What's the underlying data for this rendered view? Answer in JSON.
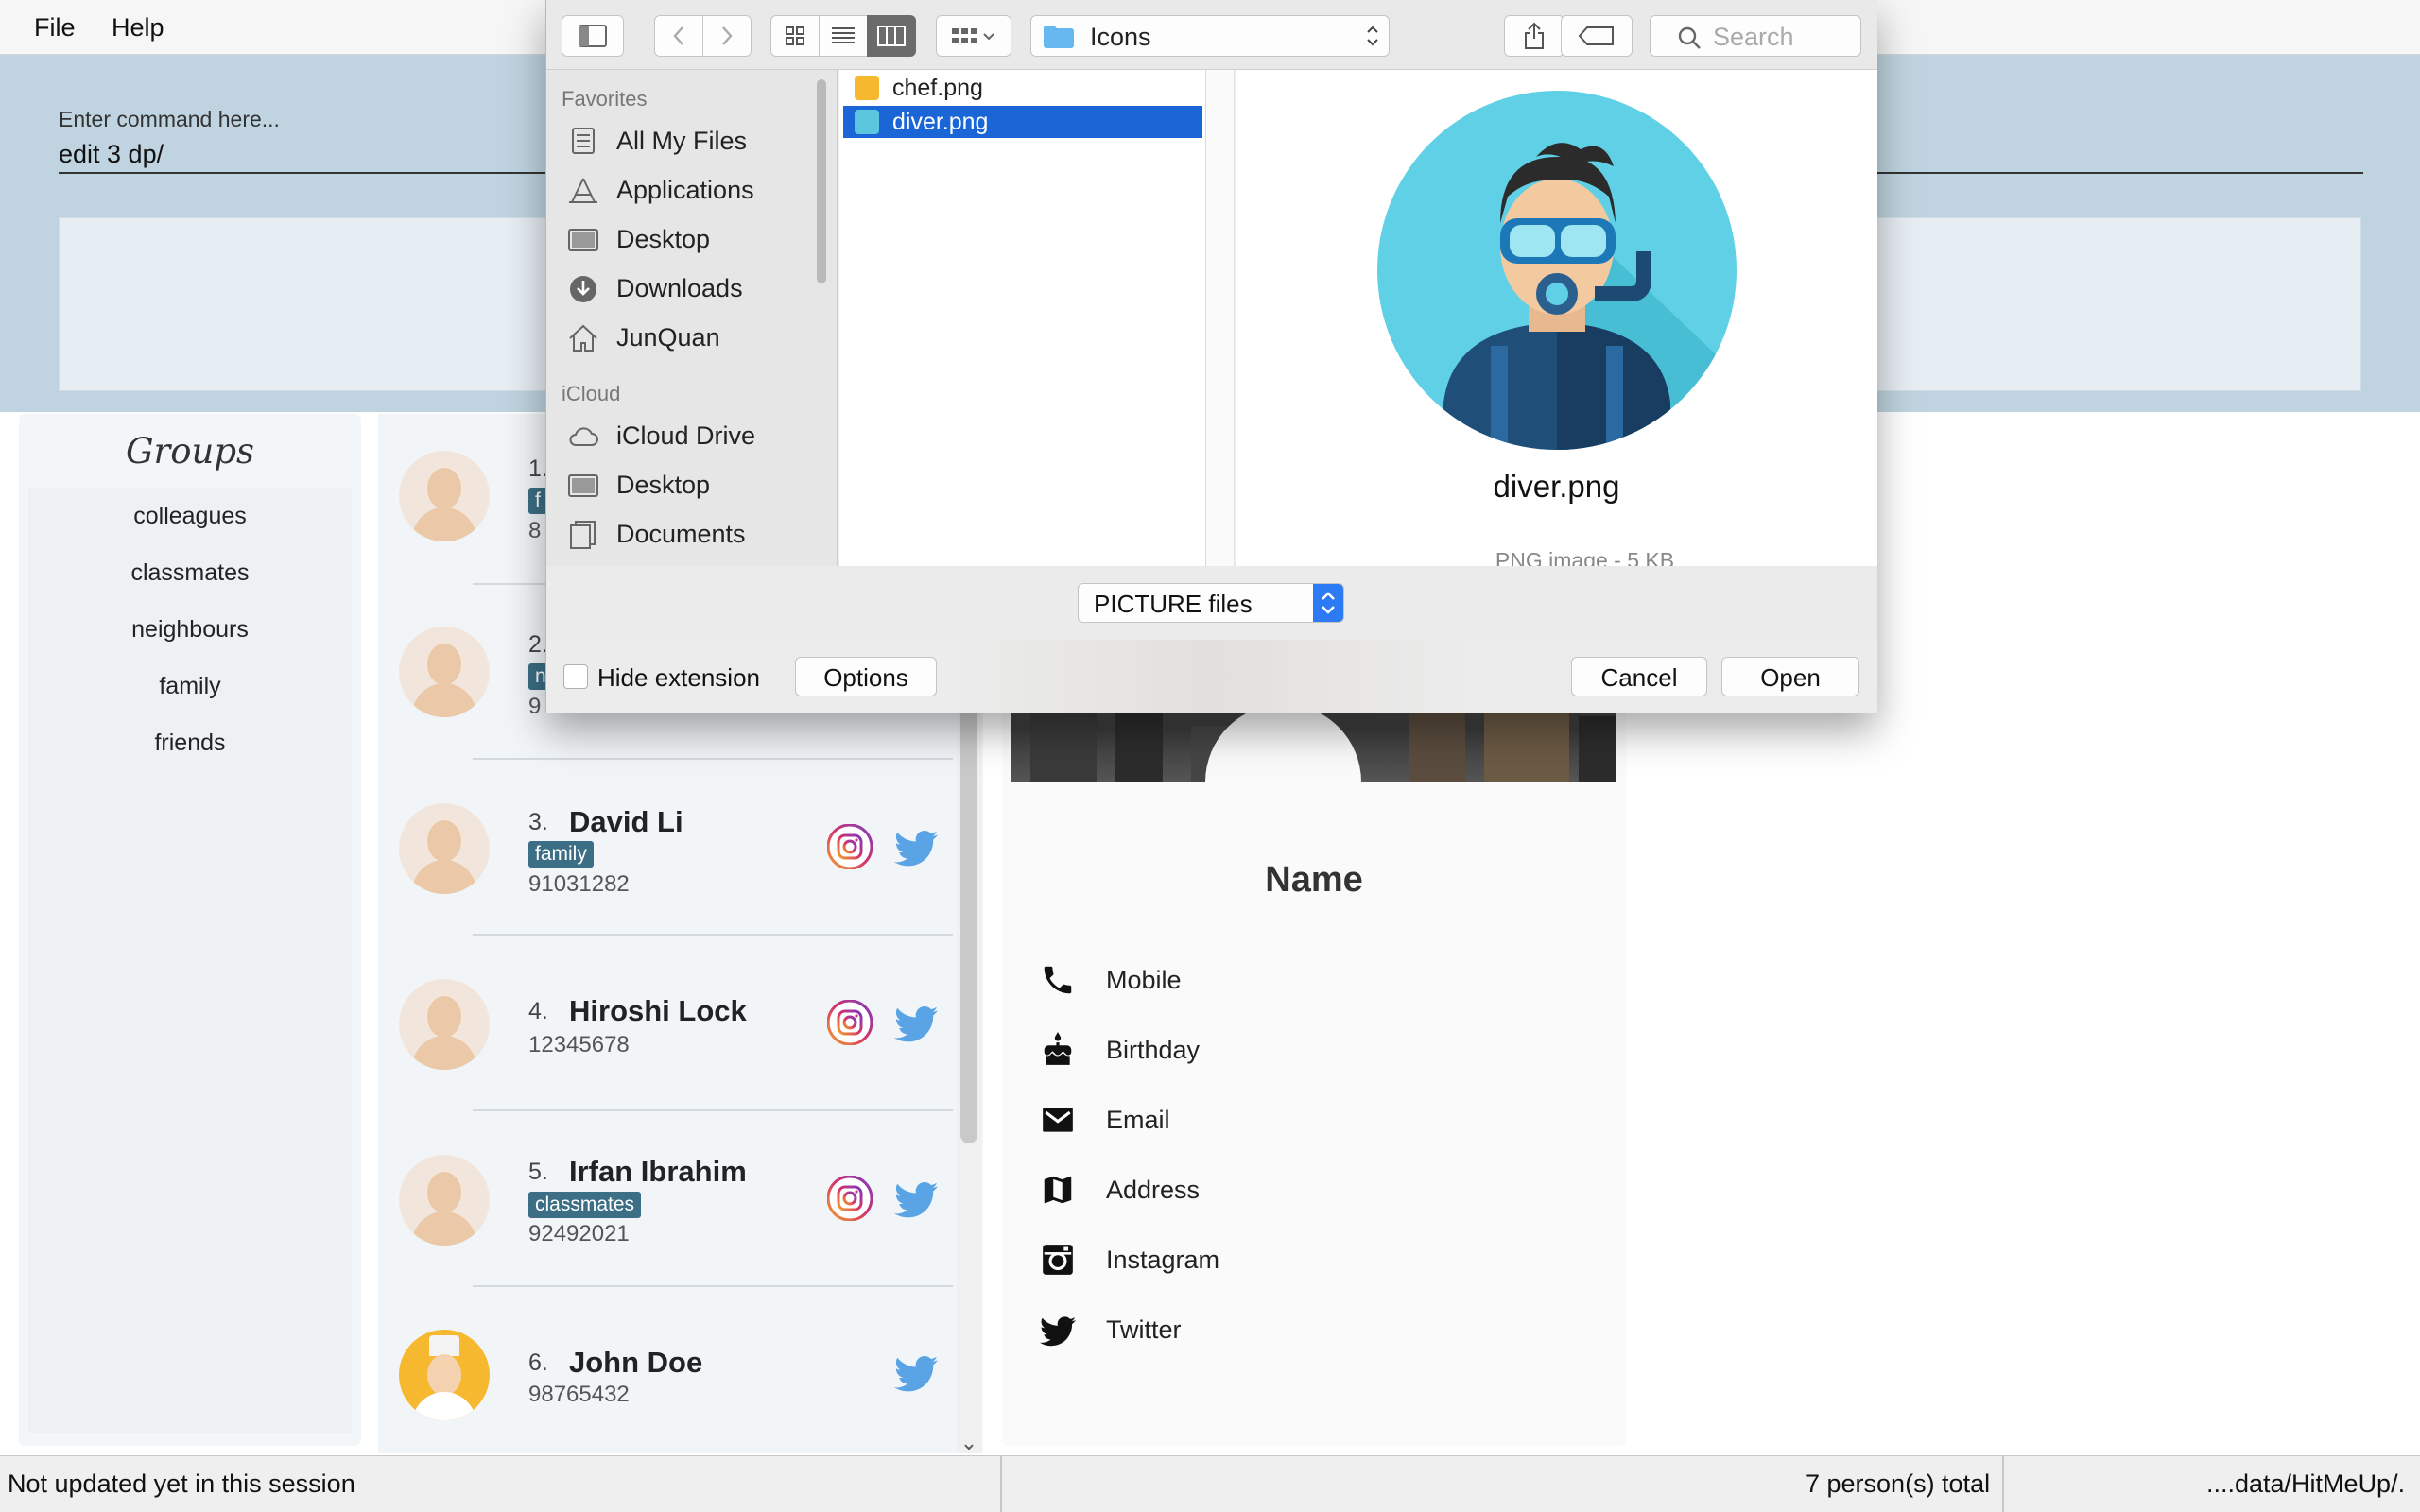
{
  "menu": {
    "file": "File",
    "help": "Help"
  },
  "command": {
    "hint": "Enter command here...",
    "value": "edit 3 dp/"
  },
  "groups": {
    "title": "Groups",
    "items": [
      "colleagues",
      "classmates",
      "neighbours",
      "family",
      "friends"
    ]
  },
  "persons": [
    {
      "index": "1.",
      "name": "",
      "tag": "f",
      "phone": "8"
    },
    {
      "index": "2.",
      "name": "",
      "tag": "n",
      "phone": "9"
    },
    {
      "index": "3.",
      "name": "David Li",
      "tag": "family",
      "phone": "91031282"
    },
    {
      "index": "4.",
      "name": "Hiroshi Lock",
      "tag": "",
      "phone": "12345678"
    },
    {
      "index": "5.",
      "name": "Irfan Ibrahim",
      "tag": "classmates",
      "phone": "92492021"
    },
    {
      "index": "6.",
      "name": "John Doe",
      "tag": "",
      "phone": "98765432"
    }
  ],
  "card": {
    "name": "Name",
    "fields": [
      "Mobile",
      "Birthday",
      "Email",
      "Address",
      "Instagram",
      "Twitter"
    ]
  },
  "status": {
    "left": "Not updated yet in this session",
    "count": "7 person(s) total",
    "path": "....data/HitMeUp/."
  },
  "dialog": {
    "location": "Icons",
    "search_placeholder": "Search",
    "sidebar": {
      "favorites_header": "Favorites",
      "favorites": [
        "All My Files",
        "Applications",
        "Desktop",
        "Downloads",
        "JunQuan"
      ],
      "icloud_header": "iCloud",
      "icloud": [
        "iCloud Drive",
        "Desktop",
        "Documents"
      ]
    },
    "files": [
      "chef.png",
      "diver.png"
    ],
    "selected_file": "diver.png",
    "preview": {
      "name": "diver.png",
      "meta": "PNG image - 5 KB"
    },
    "format": "PICTURE files",
    "hide_extension": "Hide extension",
    "options": "Options",
    "cancel": "Cancel",
    "open": "Open"
  },
  "colors": {
    "accent": "#1a66d6",
    "tag": "#3c6e85",
    "twitter": "#5aa4e6",
    "command_area": "#bfd4e0"
  }
}
